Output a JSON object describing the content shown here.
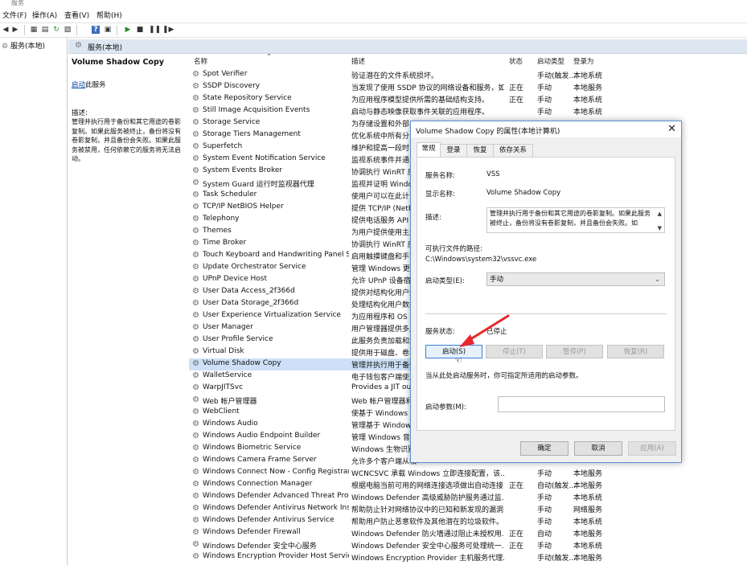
{
  "window": {
    "title": "服务"
  },
  "menu": [
    "文件(F)",
    "操作(A)",
    "查看(V)",
    "帮助(H)"
  ],
  "toolbar": {
    "icons": [
      "back-icon",
      "forward-icon",
      "console-tree-icon",
      "properties-icon",
      "refresh-icon",
      "export-icon",
      "help-icon",
      "view-icon",
      "play-icon",
      "stop-icon",
      "pause-icon",
      "restart-icon"
    ]
  },
  "tree": {
    "item": "服务(本地)"
  },
  "header": {
    "label": "服务(本地)"
  },
  "desc_pane": {
    "title": "Volume Shadow Copy",
    "link": "启动",
    "link_suffix": "此服务",
    "label": "描述:",
    "body": "管理并执行用于备份和其它用途的卷影复制。如果此服务被终止，备份将没有卷影复制，并且备份会失败。如果此服务被禁用，任何依赖它的服务将无法启动。"
  },
  "columns": {
    "name": "名称",
    "desc": "描述",
    "status": "状态",
    "startup": "启动类型",
    "logon": "登录为"
  },
  "services": [
    {
      "name": "Spot Verifier",
      "desc": "验证潜在的文件系统损坏。",
      "status": "",
      "startup": "手动(触发...",
      "logon": "本地系统"
    },
    {
      "name": "SSDP Discovery",
      "desc": "当发现了使用 SSDP 协议的网络设备和服务，如...",
      "status": "正在",
      "startup": "手动",
      "logon": "本地服务"
    },
    {
      "name": "State Repository Service",
      "desc": "为应用程序模型提供所需的基础结构支持。",
      "status": "正在",
      "startup": "手动",
      "logon": "本地系统"
    },
    {
      "name": "Still Image Acquisition Events",
      "desc": "启动与静态映像获取事件关联的应用程序。",
      "status": "",
      "startup": "手动",
      "logon": "本地系统"
    },
    {
      "name": "Storage Service",
      "desc": "为存储设置和外部",
      "status": "",
      "startup": "",
      "logon": ""
    },
    {
      "name": "Storage Tiers Management",
      "desc": "优化系统中所有分",
      "status": "",
      "startup": "",
      "logon": ""
    },
    {
      "name": "Superfetch",
      "desc": "维护和提高一段时",
      "status": "",
      "startup": "",
      "logon": ""
    },
    {
      "name": "System Event Notification Service",
      "desc": "监视系统事件并通",
      "status": "",
      "startup": "",
      "logon": ""
    },
    {
      "name": "System Events Broker",
      "desc": "协调执行 WinRT 应",
      "status": "",
      "startup": "",
      "logon": ""
    },
    {
      "name": "System Guard 运行时监视器代理",
      "desc": "监视并证明 Windo",
      "status": "",
      "startup": "",
      "logon": ""
    },
    {
      "name": "Task Scheduler",
      "desc": "使用户可以在此计",
      "status": "",
      "startup": "",
      "logon": ""
    },
    {
      "name": "TCP/IP NetBIOS Helper",
      "desc": "提供 TCP/IP (NetB",
      "status": "",
      "startup": "",
      "logon": ""
    },
    {
      "name": "Telephony",
      "desc": "提供电话服务 API (",
      "status": "",
      "startup": "",
      "logon": ""
    },
    {
      "name": "Themes",
      "desc": "为用户提供使用主题",
      "status": "",
      "startup": "",
      "logon": ""
    },
    {
      "name": "Time Broker",
      "desc": "协调执行 WinRT 应",
      "status": "",
      "startup": "",
      "logon": ""
    },
    {
      "name": "Touch Keyboard and Handwriting Panel S...",
      "desc": "启用触摸键盘和手写",
      "status": "",
      "startup": "",
      "logon": ""
    },
    {
      "name": "Update Orchestrator Service",
      "desc": "管理 Windows 更新",
      "status": "",
      "startup": "",
      "logon": ""
    },
    {
      "name": "UPnP Device Host",
      "desc": "允许 UPnP 设备宿主",
      "status": "",
      "startup": "",
      "logon": ""
    },
    {
      "name": "User Data Access_2f366d",
      "desc": "提供对结构化用户数",
      "status": "",
      "startup": "",
      "logon": ""
    },
    {
      "name": "User Data Storage_2f366d",
      "desc": "处理结构化用户数据",
      "status": "",
      "startup": "",
      "logon": ""
    },
    {
      "name": "User Experience Virtualization Service",
      "desc": "为应用程序和 OS 设",
      "status": "",
      "startup": "",
      "logon": ""
    },
    {
      "name": "User Manager",
      "desc": "用户管理器提供多用",
      "status": "",
      "startup": "",
      "logon": ""
    },
    {
      "name": "User Profile Service",
      "desc": "此服务负责加载和卸",
      "status": "",
      "startup": "",
      "logon": ""
    },
    {
      "name": "Virtual Disk",
      "desc": "提供用于磁盘、卷、",
      "status": "",
      "startup": "",
      "logon": ""
    },
    {
      "name": "Volume Shadow Copy",
      "desc": "管理并执行用于备份",
      "status": "",
      "startup": "",
      "logon": "",
      "selected": true
    },
    {
      "name": "WalletService",
      "desc": "电子钱包客户端使用",
      "status": "",
      "startup": "",
      "logon": ""
    },
    {
      "name": "WarpJITSvc",
      "desc": "Provides a JIT out",
      "status": "",
      "startup": "",
      "logon": ""
    },
    {
      "name": "Web 帐户管理器",
      "desc": "Web 帐户管理器利",
      "status": "",
      "startup": "",
      "logon": ""
    },
    {
      "name": "WebClient",
      "desc": "使基于 Windows 的",
      "status": "",
      "startup": "",
      "logon": ""
    },
    {
      "name": "Windows Audio",
      "desc": "管理基于 Windows",
      "status": "",
      "startup": "",
      "logon": ""
    },
    {
      "name": "Windows Audio Endpoint Builder",
      "desc": "管理 Windows 音频",
      "status": "",
      "startup": "",
      "logon": ""
    },
    {
      "name": "Windows Biometric Service",
      "desc": "Windows 生物识别",
      "status": "",
      "startup": "",
      "logon": ""
    },
    {
      "name": "Windows Camera Frame Server",
      "desc": "允许多个客户端从相",
      "status": "",
      "startup": "",
      "logon": ""
    },
    {
      "name": "Windows Connect Now - Config Registrar",
      "desc": "WCNCSVC 承载 Windows 立即连接配置，该...",
      "status": "",
      "startup": "手动",
      "logon": "本地服务"
    },
    {
      "name": "Windows Connection Manager",
      "desc": "根据电脑当前可用的网络连接选项做出自动连接...",
      "status": "正在",
      "startup": "自动(触发...",
      "logon": "本地服务"
    },
    {
      "name": "Windows Defender Advanced Threat Prot...",
      "desc": "Windows Defender 高级威胁防护服务通过监...",
      "status": "",
      "startup": "手动",
      "logon": "本地系统"
    },
    {
      "name": "Windows Defender Antivirus Network Ins...",
      "desc": "帮助防止针对网络协议中的已知和新发现的漏洞...",
      "status": "",
      "startup": "手动",
      "logon": "网络服务"
    },
    {
      "name": "Windows Defender Antivirus Service",
      "desc": "帮助用户防止恶意软件及其他潜在的垃圾软件。",
      "status": "",
      "startup": "手动",
      "logon": "本地系统"
    },
    {
      "name": "Windows Defender Firewall",
      "desc": "Windows Defender 防火墙通过阻止未授权用...",
      "status": "正在",
      "startup": "自动",
      "logon": "本地服务"
    },
    {
      "name": "Windows Defender 安全中心服务",
      "desc": "Windows Defender 安全中心服务可处理统一...",
      "status": "正在",
      "startup": "手动",
      "logon": "本地系统"
    },
    {
      "name": "Windows Encryption Provider Host Service",
      "desc": "Windows Encryption Provider 主机服务代理...",
      "status": "",
      "startup": "手动(触发...",
      "logon": "本地服务"
    }
  ],
  "dialog": {
    "title": "Volume Shadow Copy 的属性(本地计算机)",
    "tabs": [
      "常规",
      "登录",
      "恢复",
      "依存关系"
    ],
    "service_name_label": "服务名称:",
    "service_name": "VSS",
    "display_name_label": "显示名称:",
    "display_name": "Volume Shadow Copy",
    "description_label": "描述:",
    "description": "管理并执行用于备份和其它用途的卷影复制。如果此服务被终止，备份将没有卷影复制，并且备份会失败。如",
    "path_label": "可执行文件的路径:",
    "path": "C:\\Windows\\system32\\vssvc.exe",
    "startup_type_label": "启动类型(E):",
    "startup_type": "手动",
    "status_label": "服务状态:",
    "status": "已停止",
    "buttons": {
      "start": "启动(S)",
      "stop": "停止(T)",
      "pause": "暂停(P)",
      "resume": "恢复(R)"
    },
    "hint": "当从此处启动服务时，你可指定所适用的启动参数。",
    "params_label": "启动参数(M):",
    "params_value": "",
    "ok": "确定",
    "cancel": "取消",
    "apply": "应用(A)"
  },
  "colors": {
    "header_bg": "#dde6f1",
    "selected_row": "#cde0f7",
    "link": "#0645ad",
    "annotation_arrow": "#e8282b",
    "dialog_border": "#5b8fd3"
  }
}
